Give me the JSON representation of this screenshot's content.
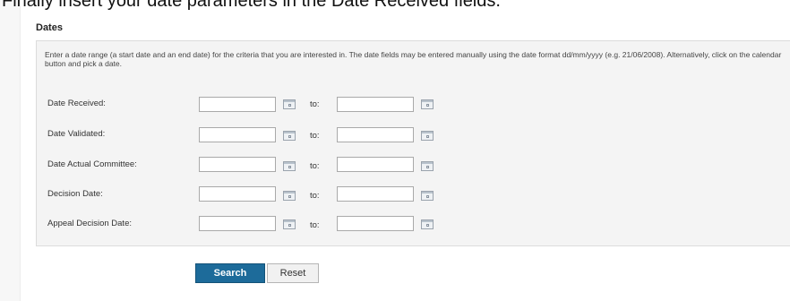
{
  "caption": "Finally insert your date parameters in the Date Received fields.",
  "section": {
    "title": "Dates",
    "instructions": "Enter a date range (a start date and an end date) for the criteria that you are interested in. The date fields may be entered manually using the date format dd/mm/yyyy (e.g. 21/06/2008). Alternatively, click on the calendar button and pick a date."
  },
  "rows": [
    {
      "label": "Date Received:",
      "to": "to:",
      "from_value": "",
      "to_value": ""
    },
    {
      "label": "Date Validated:",
      "to": "to:",
      "from_value": "",
      "to_value": ""
    },
    {
      "label": "Date Actual Committee:",
      "to": "to:",
      "from_value": "",
      "to_value": ""
    },
    {
      "label": "Decision Date:",
      "to": "to:",
      "from_value": "",
      "to_value": ""
    },
    {
      "label": "Appeal Decision Date:",
      "to": "to:",
      "from_value": "",
      "to_value": ""
    }
  ],
  "icons": {
    "calendar": "calendar-icon"
  },
  "buttons": {
    "search": "Search",
    "reset": "Reset"
  },
  "colors": {
    "search_button": "#1d6b9a",
    "panel_background": "#f4f4f4"
  }
}
